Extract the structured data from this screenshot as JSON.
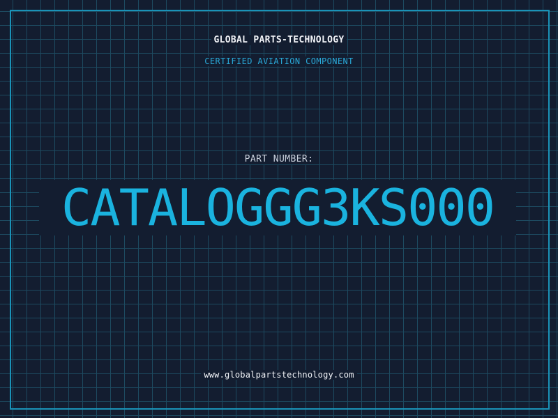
{
  "header": {
    "company": "GLOBAL PARTS-TECHNOLOGY",
    "subtitle": "CERTIFIED AVIATION COMPONENT"
  },
  "part": {
    "label": "PART NUMBER:",
    "number": "CATALOGGG3KS000"
  },
  "footer": {
    "website": "www.globalpartstechnology.com"
  },
  "colors": {
    "background": "#131d30",
    "grid": "#1d4a60",
    "frame": "#1a93b8",
    "accent": "#1ab3df",
    "text": "#f2f4f8"
  }
}
